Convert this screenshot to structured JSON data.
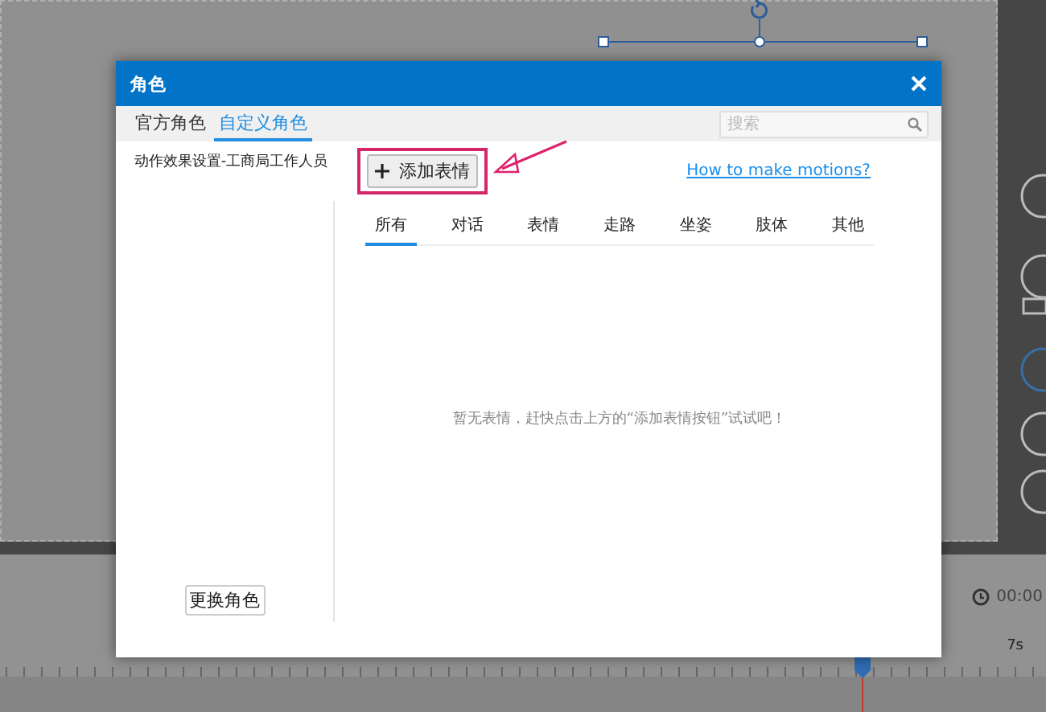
{
  "background": {
    "time": "00:00",
    "ruler_label": "7s"
  },
  "dialog": {
    "title": "角色",
    "tabs": [
      {
        "label": "官方角色",
        "selected": false
      },
      {
        "label": "自定义角色",
        "selected": true
      }
    ],
    "search": {
      "placeholder": "搜索"
    },
    "character_name": "动作效果设置-工商局工作人员",
    "add_button": "添加表情",
    "help_link": "How to make motions?",
    "categories": [
      {
        "label": "所有",
        "selected": true
      },
      {
        "label": "对话",
        "selected": false
      },
      {
        "label": "表情",
        "selected": false
      },
      {
        "label": "走路",
        "selected": false
      },
      {
        "label": "坐姿",
        "selected": false
      },
      {
        "label": "肢体",
        "selected": false
      },
      {
        "label": "其他",
        "selected": false
      }
    ],
    "empty_message": "暂无表情，赶快点击上方的“添加表情按钮”试试吧！",
    "change_button": "更换角色"
  }
}
